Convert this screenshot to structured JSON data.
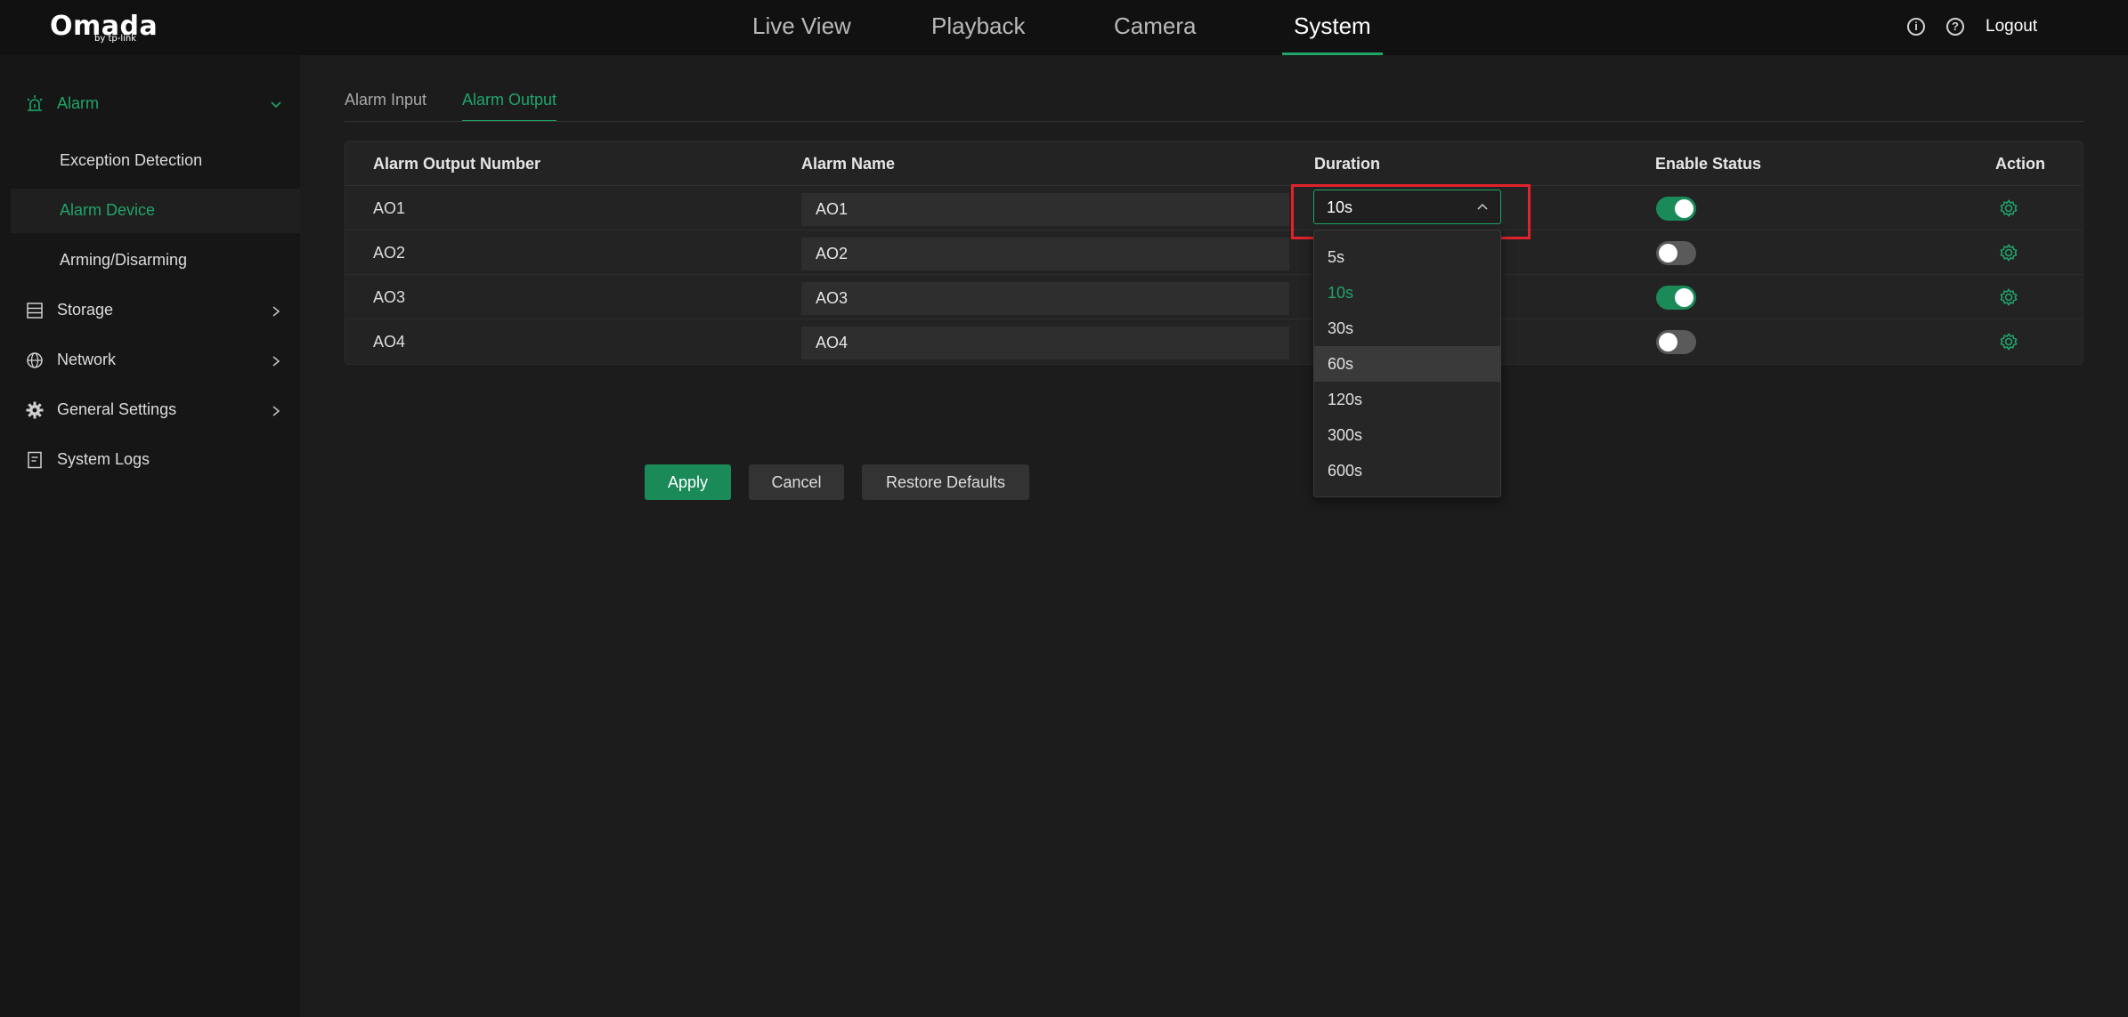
{
  "brand": {
    "name": "Omada",
    "sub": "by tp-link"
  },
  "nav": {
    "live_view": "Live View",
    "playback": "Playback",
    "camera": "Camera",
    "system": "System",
    "active": "System"
  },
  "header": {
    "info_icon_glyph": "i",
    "help_icon_glyph": "?",
    "logout": "Logout"
  },
  "sidebar": {
    "alarm": "Alarm",
    "exception_detection": "Exception Detection",
    "alarm_device": "Alarm Device",
    "arming_disarming": "Arming/Disarming",
    "storage": "Storage",
    "network": "Network",
    "general_settings": "General Settings",
    "system_logs": "System Logs",
    "active": "Alarm Device"
  },
  "tabs": {
    "alarm_input": "Alarm Input",
    "alarm_output": "Alarm Output",
    "active": "Alarm Output"
  },
  "table": {
    "headers": {
      "number": "Alarm Output Number",
      "name": "Alarm Name",
      "duration": "Duration",
      "enable": "Enable Status",
      "action": "Action"
    },
    "rows": [
      {
        "number": "AO1",
        "name": "AO1",
        "enabled": true
      },
      {
        "number": "AO2",
        "name": "AO2",
        "enabled": false
      },
      {
        "number": "AO3",
        "name": "AO3",
        "enabled": true
      },
      {
        "number": "AO4",
        "name": "AO4",
        "enabled": false
      }
    ]
  },
  "duration_select": {
    "value": "10s",
    "options": [
      "5s",
      "10s",
      "30s",
      "60s",
      "120s",
      "300s",
      "600s"
    ],
    "hovered": "60s"
  },
  "buttons": {
    "apply": "Apply",
    "cancel": "Cancel",
    "restore": "Restore Defaults"
  },
  "colors": {
    "accent": "#1fa56a",
    "highlight": "#e2222a",
    "background": "#1c1c1c"
  }
}
